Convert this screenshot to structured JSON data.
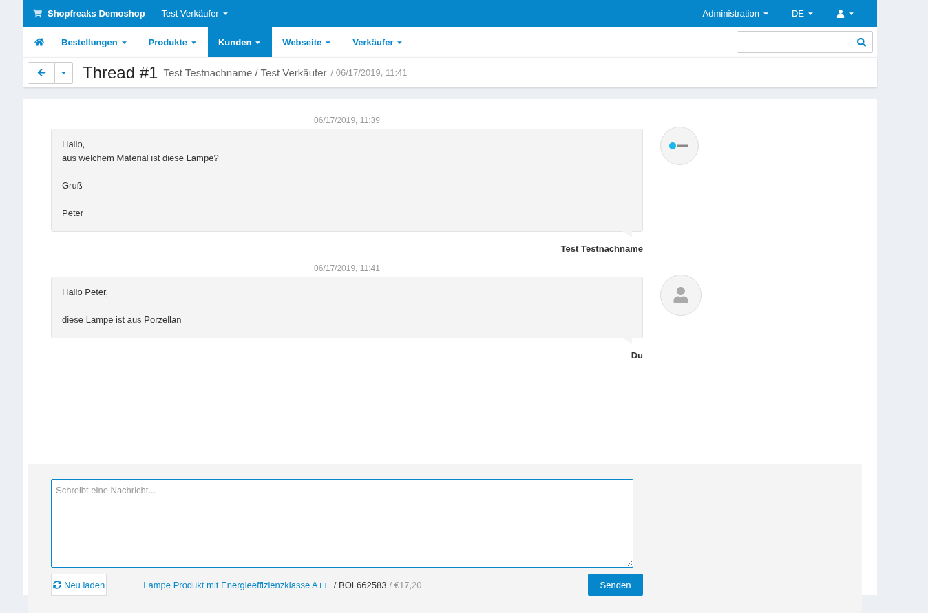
{
  "topbar": {
    "brand": "Shopfreaks Demoshop",
    "vendor": "Test Verkäufer",
    "right": [
      {
        "label": "Administration",
        "kind": "text"
      },
      {
        "label": "DE",
        "kind": "text"
      },
      {
        "kind": "user"
      }
    ]
  },
  "nav": {
    "items": [
      {
        "label": "Bestellungen",
        "selected": false
      },
      {
        "label": "Produkte",
        "selected": false
      },
      {
        "label": "Kunden",
        "selected": true
      },
      {
        "label": "Webseite",
        "selected": false
      },
      {
        "label": "Verkäufer",
        "selected": false
      }
    ]
  },
  "header": {
    "title": "Thread #1",
    "subtitle": "Test Testnachname / Test Verkäufer",
    "date": "/ 06/17/2019, 11:41"
  },
  "messages": [
    {
      "time": "06/17/2019, 11:39",
      "paragraphs": [
        [
          "Hallo,",
          "aus welchem Material ist diese Lampe?"
        ],
        [
          "Gruß"
        ],
        [
          "Peter"
        ]
      ],
      "sender": "Test Testnachname",
      "kind": "logo"
    },
    {
      "time": "06/17/2019, 11:41",
      "paragraphs": [
        [
          "Hallo Peter,"
        ],
        [
          "diese Lampe ist aus Porzellan"
        ]
      ],
      "sender": "Du",
      "kind": "person"
    }
  ],
  "compose": {
    "placeholder": "Schreibt eine Nachricht...",
    "reload": "Neu laden",
    "product": "Lampe Produkt mit Energieeffizienzklasse A++",
    "sku": "/ BOL662583",
    "price": "/ €17,20",
    "send": "Senden"
  }
}
